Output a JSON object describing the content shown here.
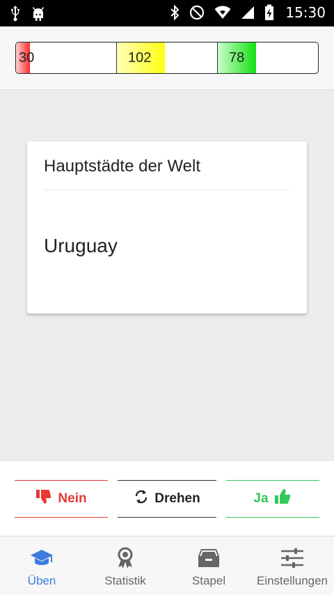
{
  "status_bar": {
    "time": "15:30",
    "left_icons": [
      "usb-icon",
      "android-icon"
    ],
    "right_icons": [
      "bluetooth-icon",
      "do-not-disturb-icon",
      "wifi-icon",
      "cell-signal-icon",
      "battery-charging-icon"
    ]
  },
  "progress": {
    "segments": [
      {
        "name": "red",
        "count": "30",
        "fill_fraction": 0.14,
        "color": "#ff2a2a"
      },
      {
        "name": "yellow",
        "count": "102",
        "fill_fraction": 0.48,
        "color": "#ffff10"
      },
      {
        "name": "green",
        "count": "78",
        "fill_fraction": 0.38,
        "color": "#15e015"
      }
    ]
  },
  "card": {
    "title": "Hauptstädte der Welt",
    "question": "Uruguay"
  },
  "answers": {
    "no_label": "Nein",
    "flip_label": "Drehen",
    "yes_label": "Ja",
    "no_color": "#e53935",
    "yes_color": "#34c759"
  },
  "nav": {
    "items": [
      {
        "label": "Üben",
        "icon": "graduation-cap-icon",
        "active": true
      },
      {
        "label": "Statistik",
        "icon": "award-ribbon-icon",
        "active": false
      },
      {
        "label": "Stapel",
        "icon": "archive-box-icon",
        "active": false
      },
      {
        "label": "Einstellungen",
        "icon": "sliders-icon",
        "active": false
      }
    ],
    "active_color": "#3d7be0"
  }
}
